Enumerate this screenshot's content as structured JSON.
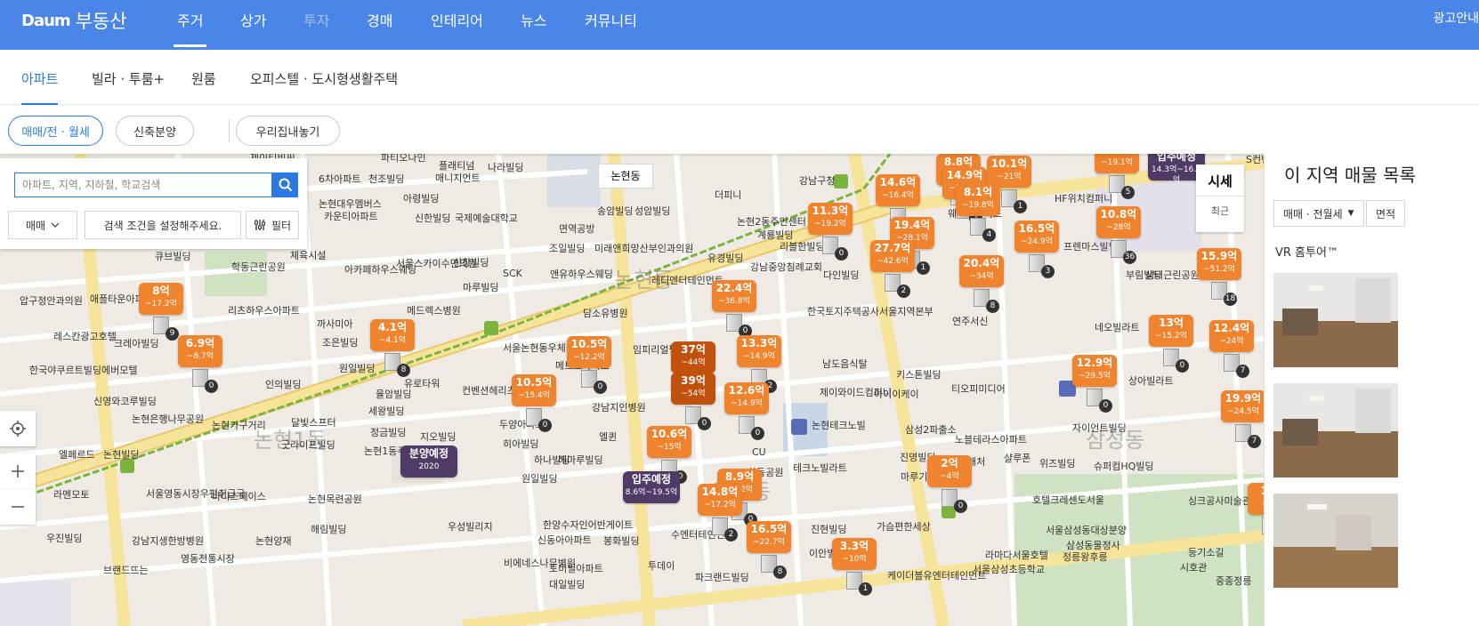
{
  "logo": {
    "brand": "Daum",
    "service": "부동산"
  },
  "topnav": {
    "items": [
      {
        "label": "주거",
        "active": true
      },
      {
        "label": "상가"
      },
      {
        "label": "투자"
      },
      {
        "label": "경매"
      },
      {
        "label": "인테리어"
      },
      {
        "label": "뉴스"
      },
      {
        "label": "커뮤니티"
      }
    ],
    "ad_label": "광고안내"
  },
  "subnav": {
    "items": [
      "아파트",
      "빌라 · 투룸+",
      "원룸",
      "오피스텔 · 도시형생활주택"
    ]
  },
  "filters": {
    "pill_1": "매매/전 · 월세",
    "pill_2": "신축분양",
    "pill_3": "우리집내놓기"
  },
  "search": {
    "placeholder": "아파트, 지역, 지하철, 학교검색",
    "deal_type": "매매",
    "condition_text": "검색 조건을 설정해주세요.",
    "filter_label": "필터"
  },
  "map": {
    "area_label": "논현동",
    "market_tab": "시세",
    "recent_tab": "최근",
    "district_labels": [
      "논현동",
      "논현1동",
      "역삼동",
      "삼성동"
    ],
    "pois": [
      "파티오나인",
      "플래티넘",
      "매니지먼트",
      "나라빌딩",
      "논현일신",
      "6차아파트",
      "천조빌딩",
      "제이티비씨",
      "논현대우멤버스",
      "카운티아파트",
      "아령빌딩",
      "신한빌딩",
      "국제예술대학교",
      "면역공방",
      "송암빌딩",
      "성암빌딩",
      "조일빌딩",
      "미래앤희망산부인과의원",
      "앤유하우스웨딩",
      "담소유병원",
      "큐브빌딩",
      "체육시설",
      "아카페하우스웨딩",
      "서울스카이수면의원",
      "신창빌딩",
      "마루빌딩",
      "SCK",
      "레디엔터테인먼트",
      "유경빌딩",
      "강남중앙침례교회",
      "계룡빌딩",
      "리블한빌딩",
      "다인빌딩",
      "학동근린공원",
      "압구정안과의원",
      "애플타운아파트",
      "리츠하우스아파트",
      "까사미아",
      "메드렉스병원",
      "레스칸광고호텔",
      "크레아빌딩",
      "조은빌딩",
      "원일빌딩",
      "에버모텔",
      "한국야쿠르트빌딩",
      "인의빌딩",
      "율암빌딩",
      "유로타워",
      "서울논현동우체국",
      "컨벤션헤리츠",
      "메트로아파트",
      "임피리얼팰리스서울",
      "한국토지주택공사서울지역본부",
      "남도음식탈",
      "키스톤빌딩",
      "제이와이드컴퍼니",
      "아이이케이",
      "티오피미디어",
      "신영와코루빌딩",
      "논현은행나무공원",
      "논현가구거리",
      "달빛스프터",
      "세왕빌딩",
      "정금빌딩",
      "굿라이프빌딩",
      "지오빌딩",
      "논현1동주민센터",
      "히아빌딩",
      "두양아파트",
      "강남지인병원",
      "해마루빌딩",
      "엘퀸",
      "하나빌딩",
      "원일빌딩",
      "논현빌딩",
      "엘페르드",
      "라멘모토",
      "서울영동시장우편취급국",
      "바디스페이스",
      "논현목련공원",
      "우진빌딩",
      "해림빌딩",
      "강남지생한방병원",
      "영동전통시장",
      "논현양재",
      "브랜드뜨는",
      "우성빌리지",
      "한양수자인어반게이트",
      "봉화빌딩",
      "신동아아파트",
      "비에네스나무병원",
      "토미빌아파트",
      "대일빌딩",
      "투데이",
      "파크랜드빌딩",
      "수엔터테인먼트",
      "진현빌딩",
      "이안빌딩",
      "가슴편한세상",
      "케이더블유엔터테인먼트",
      "라마다서울호텔",
      "서울삼성초등학교",
      "연주서신",
      "CU",
      "학동공원",
      "테크노빌라트",
      "논현테크노빌",
      "삼성2파출소",
      "노블테라스아파트",
      "진영빌딩",
      "마루기획",
      "캐처",
      "샬루폰",
      "위즈빌딩",
      "슈퍼컴HQ빌딩",
      "호텔크레센도서울",
      "서울삼성동대상분양",
      "삼성동물정사",
      "정릉왕후릉",
      "싱크공사미술관",
      "등기소길",
      "중종정릉",
      "시호관",
      "상아빌라트",
      "자이언트빌딩",
      "네오빌라트",
      "부림빌딩",
      "프렌마스빌딩",
      "샘터근린공원",
      "HF위치컴퍼니",
      "강남구청",
      "더피니",
      "논현2동주민센터",
      "S컨벤션",
      "웨스트라이프",
      "세란빌딩"
    ],
    "markers": [
      {
        "price": "8억",
        "range": "~17.2억",
        "count": "9"
      },
      {
        "price": "6.9억",
        "range": "~8.7억",
        "count": "0"
      },
      {
        "price": "4.1억",
        "range": "~4.1억",
        "count": "8"
      },
      {
        "price": "10.5억",
        "range": "~12.2억",
        "count": "0"
      },
      {
        "price": "10.5억",
        "range": "~15.4억",
        "count": "0"
      },
      {
        "price": "22.4억",
        "range": "~36.8억",
        "count": "0"
      },
      {
        "price": "37억",
        "range": "~44억",
        "count": "3"
      },
      {
        "price": "39억",
        "range": "~54억",
        "count": "0"
      },
      {
        "price": "13.3억",
        "range": "~14.9억",
        "count": "2"
      },
      {
        "price": "12.6억",
        "range": "~14.9억",
        "count": "0"
      },
      {
        "price": "10.6억",
        "range": "~15억",
        "count": "0"
      },
      {
        "price": "8.9억",
        "range": "~9.2억",
        "count": "0"
      },
      {
        "price": "14.8억",
        "range": "~17.2억",
        "count": "2"
      },
      {
        "price": "16.5억",
        "range": "~22.7억",
        "count": "8"
      },
      {
        "price": "3.3억",
        "range": "~10억",
        "count": "1"
      },
      {
        "price": "11.3억",
        "range": "~19.2억",
        "count": "0"
      },
      {
        "price": "14.6억",
        "range": "~16.4억",
        "count": "1"
      },
      {
        "price": "19.4억",
        "range": "~28.1억",
        "count": "1"
      },
      {
        "price": "27.7억",
        "range": "~42.6억",
        "count": "2"
      },
      {
        "price": "8.8억",
        "range": "~10.9억",
        "count": "1"
      },
      {
        "price": "14.9억",
        "range": "~19.8억",
        "count": "2"
      },
      {
        "price": "10.1억",
        "range": "~21억",
        "count": "1"
      },
      {
        "price": "8.1억",
        "range": "~19.8억",
        "count": "4"
      },
      {
        "price": "16.5억",
        "range": "~24.9억",
        "count": "3"
      },
      {
        "price": "20.4억",
        "range": "~34억",
        "count": "8"
      },
      {
        "price": "10.8억",
        "range": "~28억",
        "count": "36"
      },
      {
        "price": "15.9억",
        "range": "~51.2억",
        "count": "18"
      },
      {
        "price": "13억",
        "range": "~15.2억",
        "count": "0"
      },
      {
        "price": "12.4억",
        "range": "~24억",
        "count": "7"
      },
      {
        "price": "12.9억",
        "range": "~29.5억",
        "count": "0"
      },
      {
        "price": "19.9억",
        "range": "~24.5억",
        "count": "7"
      },
      {
        "price": "2억",
        "range": "~4억",
        "count": "0"
      },
      {
        "price": "14.6억",
        "range": "~19.1억",
        "count": "5"
      },
      {
        "price": "11.",
        "range": "~14",
        "count": ""
      }
    ],
    "special_markers": [
      {
        "title": "분양예정",
        "sub": "2020"
      },
      {
        "title": "입주예정",
        "sub": "8.6억~19.5억"
      },
      {
        "title": "입주예정",
        "sub": "14.3억~16.4억"
      }
    ]
  },
  "right_panel": {
    "title": "이 지역 매물 목록",
    "deal_select": "매매 · 전월세",
    "area_select": "면적",
    "vr_label": "VR 홈투어™"
  }
}
